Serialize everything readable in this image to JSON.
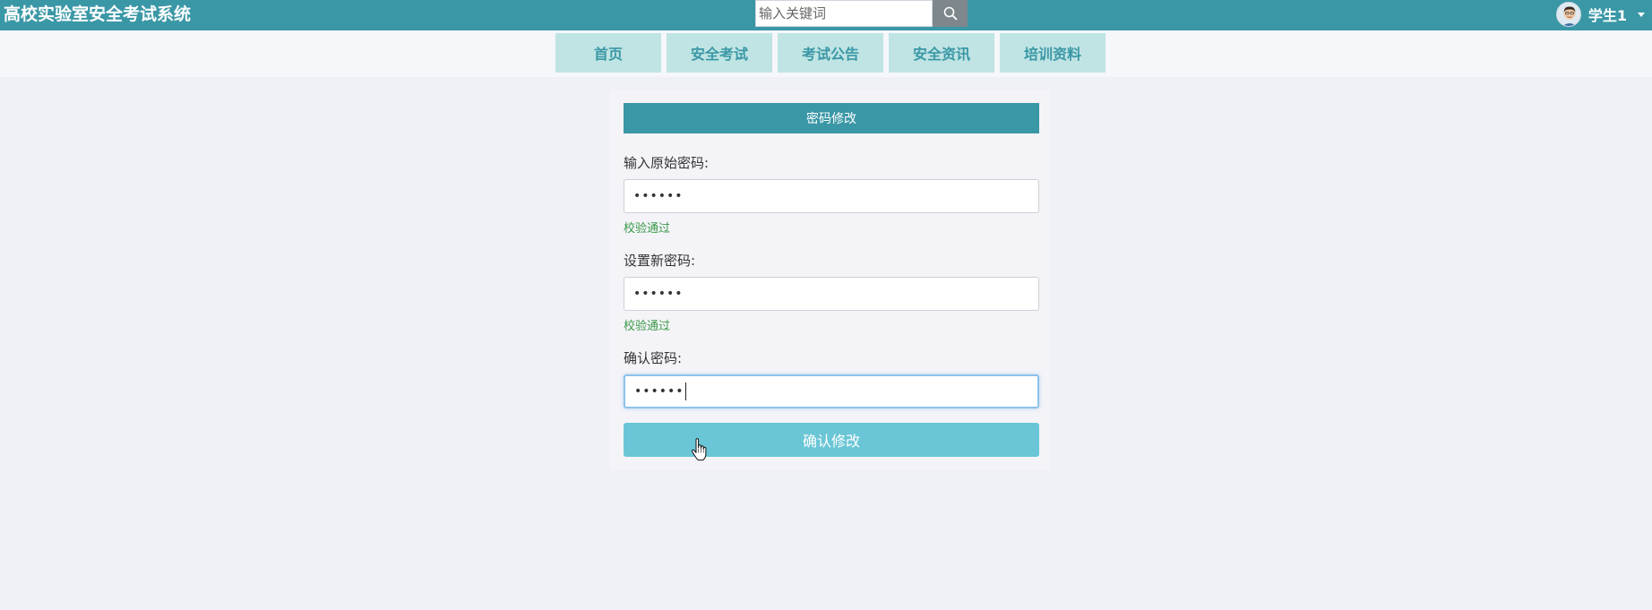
{
  "app": {
    "title": "高校实验室安全考试系统"
  },
  "search": {
    "placeholder": "输入关键词",
    "icon": "search-icon"
  },
  "user": {
    "name": "学生1",
    "avatar_icon": "avatar-icon"
  },
  "nav": {
    "items": [
      {
        "label": "首页"
      },
      {
        "label": "安全考试"
      },
      {
        "label": "考试公告"
      },
      {
        "label": "安全资讯"
      },
      {
        "label": "培训资料"
      }
    ]
  },
  "form": {
    "title": "密码修改",
    "old_password": {
      "label": "输入原始密码:",
      "value": "••••••",
      "validation": "校验通过"
    },
    "new_password": {
      "label": "设置新密码:",
      "value": "••••••",
      "validation": "校验通过"
    },
    "confirm_password": {
      "label": "确认密码:",
      "value": "••••••"
    },
    "submit_label": "确认修改"
  },
  "colors": {
    "primary": "#3a97a6",
    "nav_bg": "#bfe4e3",
    "button": "#6ac6d6",
    "success": "#3c9a48"
  }
}
